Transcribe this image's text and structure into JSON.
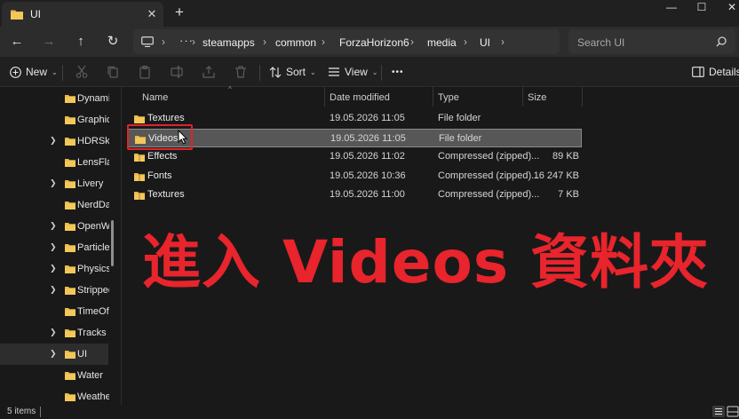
{
  "tab": {
    "title": "UI",
    "close_glyph": "✕",
    "new_tab_glyph": "+"
  },
  "window": {
    "minimize": "—",
    "maximize": "☐",
    "close": "✕"
  },
  "nav": {
    "back": "←",
    "forward": "→",
    "up": "↑",
    "refresh": "↻"
  },
  "address": {
    "more": "···",
    "crumbs": [
      "steamapps",
      "common",
      "ForzaHorizon6",
      "media",
      "UI"
    ],
    "chevron": "›"
  },
  "search": {
    "placeholder": "Search UI"
  },
  "toolbar": {
    "new_label": "New",
    "sort_label": "Sort",
    "view_label": "View",
    "more_label": "•••",
    "details_label": "Details",
    "caret": "⌄"
  },
  "sidebar": {
    "items": [
      {
        "label": "Dynamic",
        "expandable": false
      },
      {
        "label": "GraphicsI",
        "expandable": false
      },
      {
        "label": "HDRSkie",
        "expandable": true
      },
      {
        "label": "LensFlare",
        "expandable": false
      },
      {
        "label": "Livery",
        "expandable": true
      },
      {
        "label": "NerdDat",
        "expandable": false
      },
      {
        "label": "OpenWo",
        "expandable": true
      },
      {
        "label": "Particles",
        "expandable": true
      },
      {
        "label": "Physics",
        "expandable": true
      },
      {
        "label": "Stripped",
        "expandable": true
      },
      {
        "label": "TimeOfD",
        "expandable": false
      },
      {
        "label": "Tracks",
        "expandable": true
      },
      {
        "label": "UI",
        "expandable": true,
        "selected": true
      },
      {
        "label": "Water",
        "expandable": false
      },
      {
        "label": "Weather",
        "expandable": false
      }
    ]
  },
  "columns": {
    "name": "Name",
    "date": "Date modified",
    "type": "Type",
    "size": "Size"
  },
  "files": [
    {
      "name": "Textures",
      "date": "19.05.2026 11:05",
      "type": "File folder",
      "size": "",
      "kind": "folder"
    },
    {
      "name": "Videos",
      "date": "19.05.2026 11:05",
      "type": "File folder",
      "size": "",
      "kind": "folder",
      "selected": true
    },
    {
      "name": "Effects",
      "date": "19.05.2026 11:02",
      "type": "Compressed (zipped)...",
      "size": "89 KB",
      "kind": "zip"
    },
    {
      "name": "Fonts",
      "date": "19.05.2026 10:36",
      "type": "Compressed (zipped)...",
      "size": "16 247 KB",
      "kind": "zip"
    },
    {
      "name": "Textures",
      "date": "19.05.2026 11:00",
      "type": "Compressed (zipped)...",
      "size": "7 KB",
      "kind": "zip"
    }
  ],
  "caption": "進入 Videos 資料夾",
  "status": {
    "count": "5 items"
  },
  "colors": {
    "accent_red": "#e8242c",
    "folder_yellow": "#e8b84a",
    "selection": "#575757"
  }
}
